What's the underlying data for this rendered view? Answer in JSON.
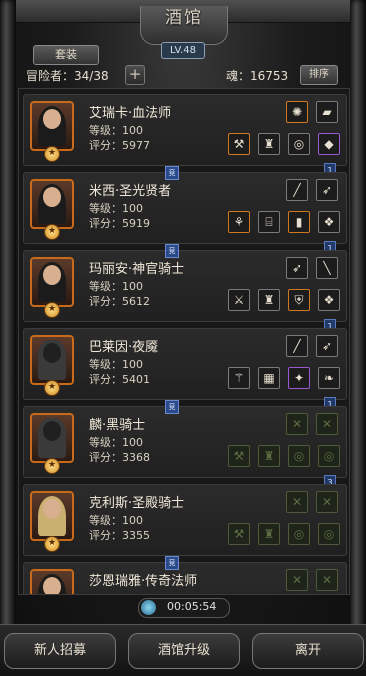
{
  "header": {
    "title": "酒馆",
    "level": "LV.48",
    "set_label": "套装",
    "adventurer_count": "冒险者：34/38",
    "plus_label": "+",
    "soul": "魂：16753",
    "sort_label": "排序"
  },
  "heroes": [
    {
      "name": "艾瑞卡·血法师",
      "level": "等级：100",
      "score": "评分：5977",
      "slots_top": [
        {
          "icon": "fire-orb-icon",
          "glyph": "✺",
          "rarity": "orange"
        },
        {
          "icon": "blade-card-icon",
          "glyph": "▰",
          "rarity": "normal"
        }
      ],
      "slots_bottom": [
        {
          "icon": "hammer-icon",
          "glyph": "⚒",
          "rarity": "orange"
        },
        {
          "icon": "armor-icon",
          "glyph": "♜",
          "rarity": "normal"
        },
        {
          "icon": "ring-icon",
          "glyph": "◎",
          "rarity": "normal"
        },
        {
          "icon": "orb-icon",
          "glyph": "◆",
          "rarity": "purple"
        }
      ],
      "marker": "1"
    },
    {
      "name": "米西·圣光贤者",
      "level": "等级：100",
      "score": "评分：5919",
      "slots_top": [
        {
          "icon": "dagger-icon",
          "glyph": "╱",
          "rarity": "normal"
        },
        {
          "icon": "wing-icon",
          "glyph": "➶",
          "rarity": "normal"
        }
      ],
      "slots_bottom": [
        {
          "icon": "shoe-icon",
          "glyph": "⚘",
          "rarity": "orange"
        },
        {
          "icon": "totem-icon",
          "glyph": "⌸",
          "rarity": "normal"
        },
        {
          "icon": "book-icon",
          "glyph": "▮",
          "rarity": "orange"
        },
        {
          "icon": "gem-icon",
          "glyph": "❖",
          "rarity": "normal"
        }
      ],
      "marker": "1"
    },
    {
      "name": "玛丽安·神官骑士",
      "level": "等级：100",
      "score": "评分：5612",
      "slots_top": [
        {
          "icon": "feather-icon",
          "glyph": "➶",
          "rarity": "normal"
        },
        {
          "icon": "sword-icon",
          "glyph": "╲",
          "rarity": "normal"
        }
      ],
      "slots_bottom": [
        {
          "icon": "axe-icon",
          "glyph": "⚔",
          "rarity": "normal"
        },
        {
          "icon": "armor-icon",
          "glyph": "♜",
          "rarity": "normal"
        },
        {
          "icon": "shield-icon",
          "glyph": "⛨",
          "rarity": "orange"
        },
        {
          "icon": "gem-icon",
          "glyph": "❖",
          "rarity": "normal"
        }
      ],
      "marker": "1"
    },
    {
      "name": "巴莱因·夜魇",
      "level": "等级：100",
      "score": "评分：5401",
      "slots_top": [
        {
          "icon": "staff-icon",
          "glyph": "╱",
          "rarity": "normal"
        },
        {
          "icon": "wing-icon",
          "glyph": "➶",
          "rarity": "normal"
        }
      ],
      "slots_bottom": [
        {
          "icon": "wand-icon",
          "glyph": "⚚",
          "rarity": "normal"
        },
        {
          "icon": "cage-icon",
          "glyph": "▦",
          "rarity": "normal"
        },
        {
          "icon": "blade-icon",
          "glyph": "✦",
          "rarity": "purple"
        },
        {
          "icon": "leaf-icon",
          "glyph": "❧",
          "rarity": "normal"
        }
      ],
      "marker": "1"
    },
    {
      "name": "麟·黑骑士",
      "level": "等级：100",
      "score": "评分：3368",
      "slots_top": [
        {
          "icon": "empty-slot-icon",
          "glyph": "✕",
          "rarity": "empty"
        },
        {
          "icon": "empty-slot-icon",
          "glyph": "✕",
          "rarity": "empty"
        }
      ],
      "slots_bottom": [
        {
          "icon": "empty-weapon-icon",
          "glyph": "⚒",
          "rarity": "empty"
        },
        {
          "icon": "empty-armor-icon",
          "glyph": "♜",
          "rarity": "empty"
        },
        {
          "icon": "empty-ring-icon",
          "glyph": "◎",
          "rarity": "empty"
        },
        {
          "icon": "empty-orb-icon",
          "glyph": "◎",
          "rarity": "empty"
        }
      ],
      "marker": "3"
    },
    {
      "name": "克利斯·圣殿骑士",
      "level": "等级：100",
      "score": "评分：3355",
      "slots_top": [
        {
          "icon": "empty-slot-icon",
          "glyph": "✕",
          "rarity": "empty"
        },
        {
          "icon": "empty-slot-icon",
          "glyph": "✕",
          "rarity": "empty"
        }
      ],
      "slots_bottom": [
        {
          "icon": "empty-weapon-icon",
          "glyph": "⚒",
          "rarity": "empty"
        },
        {
          "icon": "empty-armor-icon",
          "glyph": "♜",
          "rarity": "empty"
        },
        {
          "icon": "empty-ring-icon",
          "glyph": "◎",
          "rarity": "empty"
        },
        {
          "icon": "empty-orb-icon",
          "glyph": "◎",
          "rarity": "empty"
        }
      ],
      "marker": ""
    },
    {
      "name": "莎恩瑞雅·传奇法师",
      "level": "",
      "score": "",
      "slots_top": [
        {
          "icon": "empty-slot-icon",
          "glyph": "✕",
          "rarity": "empty"
        },
        {
          "icon": "empty-slot-icon",
          "glyph": "✕",
          "rarity": "empty"
        }
      ],
      "slots_bottom": [],
      "marker": ""
    }
  ],
  "timer": "00:05:54",
  "bottom": {
    "recruit": "新人招募",
    "upgrade": "酒馆升级",
    "leave": "离开"
  }
}
